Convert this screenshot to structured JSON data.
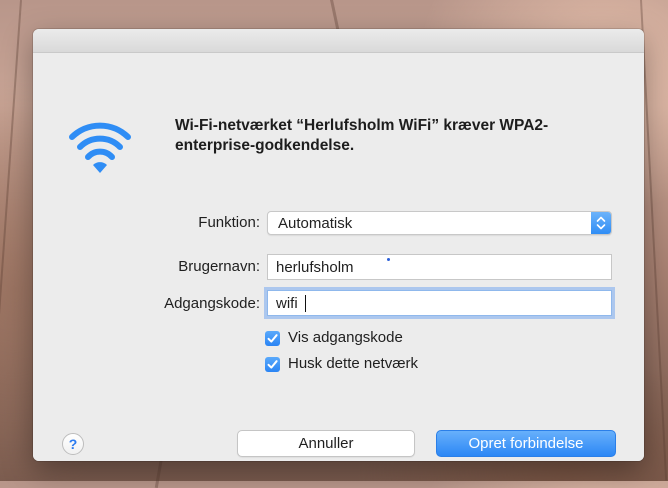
{
  "dialog": {
    "message": "Wi-Fi-netværket “Herlufsholm WiFi” kræver WPA2-enterprise-godkendelse.",
    "icon": "wifi-icon",
    "accent_color": "#2f8df5"
  },
  "form": {
    "mode_label": "Funktion:",
    "mode_value": "Automatisk",
    "username_label": "Brugernavn:",
    "username_value": "herlufsholm",
    "password_label": "Adgangskode:",
    "password_value": "wifi",
    "show_password_label": "Vis adgangskode",
    "show_password_checked": true,
    "remember_label": "Husk dette netværk",
    "remember_checked": true
  },
  "buttons": {
    "help": "?",
    "cancel": "Annuller",
    "connect": "Opret forbindelse"
  }
}
